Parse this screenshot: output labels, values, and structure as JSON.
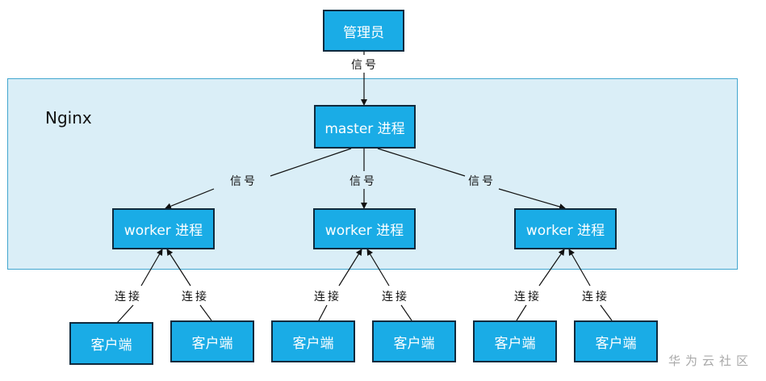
{
  "colors": {
    "node_fill": "#1aace6",
    "node_border": "#0f2a3d",
    "region_fill": "#daeef7",
    "region_border": "#41a6cf",
    "arrow": "#111111"
  },
  "nodes": {
    "admin": "管理员",
    "master": "master 进程",
    "worker_1": "worker 进程",
    "worker_2": "worker 进程",
    "worker_3": "worker 进程",
    "client_1": "客户端",
    "client_2": "客户端",
    "client_3": "客户端",
    "client_4": "客户端",
    "client_5": "客户端",
    "client_6": "客户端"
  },
  "region": {
    "label": "Nginx"
  },
  "edge_labels": {
    "admin_to_master": "信号",
    "master_to_worker_1": "信号",
    "master_to_worker_2": "信号",
    "master_to_worker_3": "信号",
    "client_1_to_worker_1": "连接",
    "client_2_to_worker_1": "连接",
    "client_3_to_worker_2": "连接",
    "client_4_to_worker_2": "连接",
    "client_5_to_worker_3": "连接",
    "client_6_to_worker_3": "连接"
  },
  "watermark": "华为云社区"
}
